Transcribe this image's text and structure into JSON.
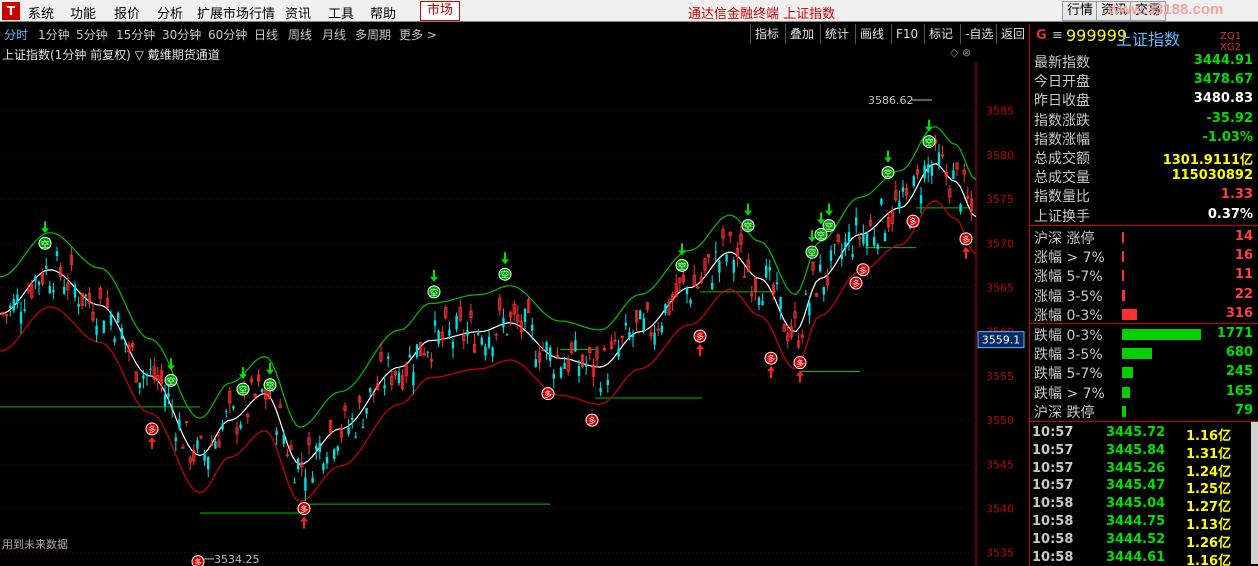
{
  "menubar": {
    "logo": "T",
    "items": [
      "系统",
      "功能",
      "报价",
      "分析",
      "扩展市场行情",
      "资讯",
      "工具",
      "帮助"
    ],
    "market_button": "市场",
    "app_title": "通达信金融终端  上证指数",
    "right_buttons": [
      "行情",
      "资讯",
      "交易"
    ],
    "watermark": "www.33188.com"
  },
  "toolbar": {
    "periods": [
      "分时",
      "1分钟",
      "5分钟",
      "15分钟",
      "30分钟",
      "60分钟",
      "日线",
      "周线",
      "月线",
      "多周期",
      "更多 >"
    ],
    "active_period": "分时",
    "tools": [
      "指标",
      "叠加",
      "统计",
      "画线",
      "F10",
      "标记",
      "-自选",
      "返回"
    ]
  },
  "chart_header": {
    "title": "上证指数(1分钟 前复权)",
    "indicator": "▽ 戴维期货通道",
    "footnote": "用到未来数据"
  },
  "chart_data": {
    "type": "candlestick",
    "yticks": [
      3585,
      3580,
      3575,
      3570,
      3565,
      3560,
      3555,
      3550,
      3545,
      3540,
      3535
    ],
    "ylim": [
      3533.5,
      3590.5
    ],
    "current_price_label": "3559.1",
    "high_label": "3586.62",
    "low_label": "3534.25",
    "buy_signal_text": "多",
    "sell_signal_text": "空"
  },
  "quote": {
    "g_label": "G",
    "menu_icon": "≡",
    "code": "999999",
    "name": "上证指数",
    "tag": "ZQ1 XG2",
    "fields": [
      {
        "label": "最新指数",
        "value": "3444.91",
        "color": "#00e000"
      },
      {
        "label": "今日开盘",
        "value": "3478.67",
        "color": "#00e000"
      },
      {
        "label": "昨日收盘",
        "value": "3480.83",
        "color": "#ffffff"
      },
      {
        "label": "指数涨跌",
        "value": "-35.92",
        "color": "#00e000"
      },
      {
        "label": "指数涨幅",
        "value": "-1.03%",
        "color": "#00e000"
      },
      {
        "label": "总成交额",
        "value": "1301.9111亿",
        "color": "#ffff00"
      },
      {
        "label": "总成交量",
        "value": "115030892",
        "color": "#ffff00"
      },
      {
        "label": "指数量比",
        "value": "1.33",
        "color": "#ff4040"
      },
      {
        "label": "上证换手",
        "value": "0.37%",
        "color": "#ffffff"
      }
    ],
    "breadth_up": [
      {
        "label": "沪深 涨停",
        "value": "14",
        "bar": 2
      },
      {
        "label": "涨幅 > 7%",
        "value": "16",
        "bar": 2
      },
      {
        "label": "涨幅 5-7%",
        "value": "11",
        "bar": 2
      },
      {
        "label": "涨幅 3-5%",
        "value": "22",
        "bar": 3
      },
      {
        "label": "涨幅 0-3%",
        "value": "316",
        "bar": 15
      }
    ],
    "breadth_down": [
      {
        "label": "跌幅 0-3%",
        "value": "1771",
        "bar": 79
      },
      {
        "label": "跌幅 3-5%",
        "value": "680",
        "bar": 30
      },
      {
        "label": "跌幅 5-7%",
        "value": "245",
        "bar": 11
      },
      {
        "label": "跌幅 > 7%",
        "value": "165",
        "bar": 8
      },
      {
        "label": "沪深 跌停",
        "value": "79",
        "bar": 4
      }
    ],
    "ticks": [
      {
        "time": "10:57",
        "price": "3445.72",
        "vol": "1.16亿"
      },
      {
        "time": "10:57",
        "price": "3445.84",
        "vol": "1.31亿"
      },
      {
        "time": "10:57",
        "price": "3445.26",
        "vol": "1.24亿"
      },
      {
        "time": "10:57",
        "price": "3445.47",
        "vol": "1.25亿"
      },
      {
        "time": "10:58",
        "price": "3445.04",
        "vol": "1.27亿"
      },
      {
        "time": "10:58",
        "price": "3444.75",
        "vol": "1.13亿"
      },
      {
        "time": "10:58",
        "price": "3444.52",
        "vol": "1.26亿"
      },
      {
        "time": "10:58",
        "price": "3444.61",
        "vol": "1.16亿"
      }
    ]
  }
}
